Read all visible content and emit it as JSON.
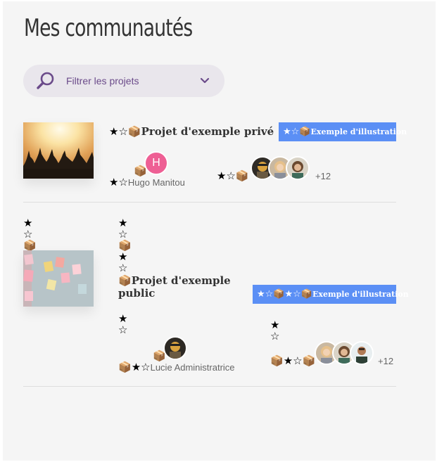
{
  "page": {
    "title": "Mes communautés"
  },
  "filter": {
    "label": "Filtrer les projets",
    "search_icon": "search-icon",
    "chevron_icon": "chevron-down-icon",
    "accent": "#6b4b8a"
  },
  "glyphs": {
    "star": "★",
    "star_outline": "☆",
    "box": "📦"
  },
  "projects": [
    {
      "title": "Projet d'exemple privé",
      "badge": "Exemple d'illustration",
      "owner": "Hugo Manitou",
      "owner_initial": "H",
      "members_more": "+12"
    },
    {
      "title_line1": "Projet d'exemple",
      "title_line2": "public",
      "badge": "Exemple d'illustration",
      "owner": "Lucie Administratrice",
      "members_more": "+12"
    }
  ],
  "colors": {
    "badge": "#5b8ff5",
    "initial_avatar": "#ee5f94"
  }
}
